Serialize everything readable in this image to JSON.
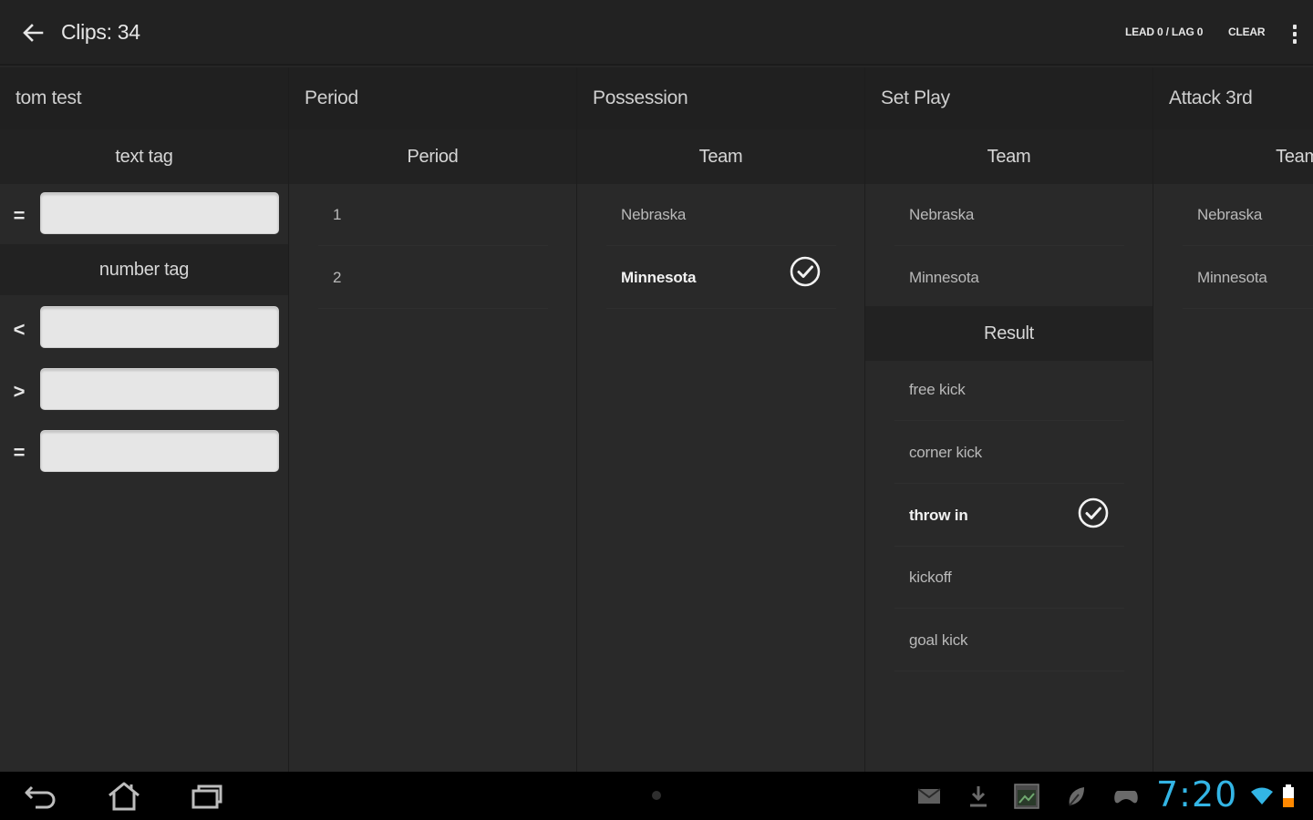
{
  "action_bar": {
    "back_icon": "arrow-back-icon",
    "title": "Clips: 34",
    "lead_lag_label": "LEAD 0 / LAG 0",
    "clear_label": "CLEAR",
    "overflow_icon": "overflow-menu-icon"
  },
  "filter_column": {
    "header": "tom test",
    "text_tag": {
      "label": "text tag",
      "operator": "=",
      "value": ""
    },
    "number_tag": {
      "label": "number tag",
      "rows": [
        {
          "operator": "<",
          "value": ""
        },
        {
          "operator": ">",
          "value": ""
        },
        {
          "operator": "=",
          "value": ""
        }
      ]
    }
  },
  "columns": [
    {
      "header": "Period",
      "groups": [
        {
          "label": "Period",
          "items": [
            {
              "label": "1",
              "selected": false
            },
            {
              "label": "2",
              "selected": false
            }
          ]
        }
      ]
    },
    {
      "header": "Possession",
      "groups": [
        {
          "label": "Team",
          "items": [
            {
              "label": "Nebraska",
              "selected": false
            },
            {
              "label": "Minnesota",
              "selected": true
            }
          ]
        }
      ]
    },
    {
      "header": "Set Play",
      "groups": [
        {
          "label": "Team",
          "items": [
            {
              "label": "Nebraska",
              "selected": false
            },
            {
              "label": "Minnesota",
              "selected": false
            }
          ]
        },
        {
          "label": "Result",
          "items": [
            {
              "label": "free kick",
              "selected": false
            },
            {
              "label": "corner kick",
              "selected": false
            },
            {
              "label": "throw in",
              "selected": true
            },
            {
              "label": "kickoff",
              "selected": false
            },
            {
              "label": "goal kick",
              "selected": false
            }
          ]
        }
      ]
    },
    {
      "header": "Attack 3rd",
      "groups": [
        {
          "label": "Team",
          "items": [
            {
              "label": "Nebraska",
              "selected": false
            },
            {
              "label": "Minnesota",
              "selected": false
            }
          ]
        }
      ]
    }
  ],
  "nav_bar": {
    "buttons": [
      "back-icon",
      "home-icon",
      "recent-apps-icon"
    ],
    "notification_icons": [
      "email-icon",
      "download-icon",
      "screenshot-icon",
      "leaf-app-icon",
      "game-controller-icon"
    ],
    "time": "7:20",
    "status_icons": [
      "wifi-icon",
      "battery-icon"
    ]
  },
  "colors": {
    "accent": "#33b5e5",
    "background": "#262626",
    "header_background": "#202020",
    "input_background": "#e6e6e6"
  }
}
